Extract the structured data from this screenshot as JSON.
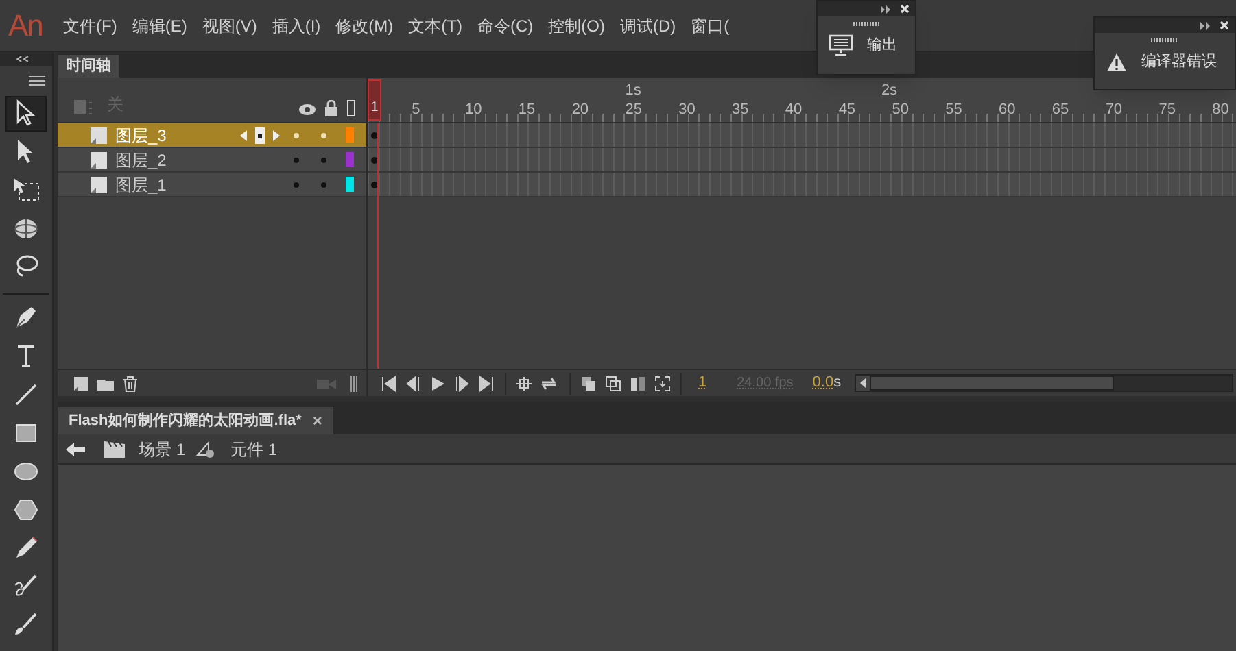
{
  "app": {
    "logo": "An"
  },
  "menu": [
    "文件(F)",
    "编辑(E)",
    "视图(V)",
    "插入(I)",
    "修改(M)",
    "文本(T)",
    "命令(C)",
    "控制(O)",
    "调试(D)",
    "窗口("
  ],
  "floating_panels": [
    {
      "title": "输出",
      "kind": "output"
    },
    {
      "title": "编译器错误",
      "kind": "errors"
    }
  ],
  "tools": [
    {
      "kind": "select",
      "selected": true
    },
    {
      "kind": "subselect",
      "selected": false
    },
    {
      "kind": "transform",
      "selected": false
    },
    {
      "kind": "rotate3d",
      "selected": false
    },
    {
      "kind": "lasso",
      "selected": false
    },
    {
      "kind": "pen",
      "selected": false
    },
    {
      "kind": "text",
      "selected": false
    },
    {
      "kind": "line",
      "selected": false
    },
    {
      "kind": "rect",
      "selected": false
    },
    {
      "kind": "oval",
      "selected": false
    },
    {
      "kind": "polygon",
      "selected": false
    },
    {
      "kind": "pencil",
      "selected": false
    },
    {
      "kind": "paintbrush",
      "selected": false
    },
    {
      "kind": "brush",
      "selected": false
    }
  ],
  "timeline": {
    "tab": "时间轴",
    "header_label": "关",
    "playhead": "1",
    "frame_labels": [
      "5",
      "10",
      "15",
      "20",
      "25",
      "30",
      "35",
      "40",
      "45",
      "50",
      "55",
      "60",
      "65",
      "70",
      "75",
      "80"
    ],
    "second_labels": [
      "1s",
      "2s"
    ],
    "layers": [
      {
        "name": "图层_3",
        "selected": true,
        "color": "#ff8000"
      },
      {
        "name": "图层_2",
        "selected": false,
        "color": "#9933cc"
      },
      {
        "name": "图层_1",
        "selected": false,
        "color": "#00e5e5"
      }
    ],
    "current_frame": "1",
    "fps": "24.00 fps",
    "time": "0.0",
    "time_unit": "s"
  },
  "document": {
    "tab": "Flash如何制作闪耀的太阳动画.fla*",
    "close": "×",
    "breadcrumb": [
      "场景 1",
      "元件 1"
    ]
  }
}
